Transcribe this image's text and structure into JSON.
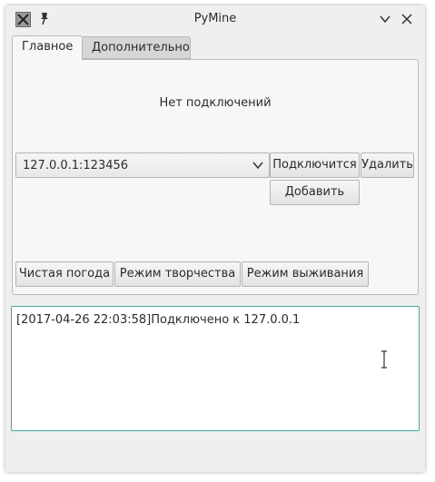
{
  "window": {
    "title": "PyMine",
    "icons": {
      "app": "app-logo-icon",
      "pin": "pin-icon",
      "minimize": "chevron-down-icon",
      "close": "close-icon"
    }
  },
  "tabs": [
    {
      "label": "Главное",
      "active": true
    },
    {
      "label": "Дополнительно",
      "active": false
    }
  ],
  "main": {
    "status_text": "Нет подключений",
    "server_select": {
      "value": "127.0.0.1:123456"
    },
    "connect_label": "Подключится",
    "delete_label": "Удалить",
    "add_label": "Добавить",
    "clear_weather_label": "Чистая погода",
    "creative_label": "Режим творчества",
    "survival_label": "Режим выживания"
  },
  "log": {
    "lines": [
      "[2017-04-26 22:03:58]Подключено к 127.0.0.1"
    ]
  },
  "colors": {
    "window_bg": "#efefef",
    "log_border_accent": "#3dae9c"
  }
}
